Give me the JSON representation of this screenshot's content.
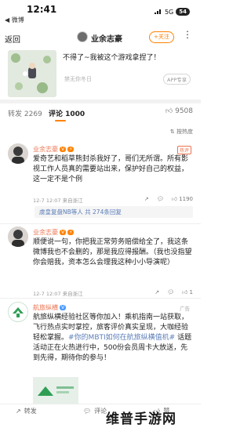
{
  "status_bar": {
    "time": "12:41",
    "back_app": "◀ 微博",
    "network": "5G",
    "battery": "54"
  },
  "navbar": {
    "back": "返回",
    "title": "业余志豪",
    "follow": "+关注",
    "more": "⋮"
  },
  "post": {
    "text": "不得了~我被这个游戏拿捏了！",
    "no_forward": "禁无你冬日",
    "app_button": "APP专享"
  },
  "tabs": {
    "forward": "转发 2269",
    "comments": "评论 1000",
    "likes": "9508"
  },
  "sort_label": "按热度",
  "comments": [
    {
      "name": "业余志豪",
      "tag": "热评",
      "text": "爱奇艺和稻草熊封杀我好了，哥们无所谓。所有影视工作人员真的需要站出来，保护好自己的权益，这一定不是个例",
      "meta": "12-7 12:07  来自浙江",
      "like_count": "1190",
      "replies": "虞皇复盘NB等人 共 274条回复"
    },
    {
      "name": "业余志豪",
      "text": "顺便说一句，你把我正常劳务赔偿给全了，我这条微博我也不会删的，那是我应得报酬。（我也没指望你会赔我，资本怎么会理我这种小小导演呢）",
      "meta": "12-7 12:07  来自浙江",
      "like_count": "1"
    },
    {
      "name": "航旅纵横",
      "ad_label": "广告",
      "text_parts": [
        "航旅纵横经验社区等你加入！乘机指南一站获取，飞行热点实时掌控，旅客评价真实呈现，大咖经验轻松掌握。",
        "#你的MBTI如何在航旅纵横值机#",
        " 话题活动正在火热进行中，500份会员周卡大放送，先到先得，期待你的参与！"
      ]
    }
  ],
  "bottom_bar": {
    "forward": "转发",
    "comment": "评论",
    "like": "赞"
  },
  "watermark": "维普手游网",
  "colors": {
    "accent": "#ff8200",
    "link": "#5b7db8",
    "name": "#eb7350"
  }
}
